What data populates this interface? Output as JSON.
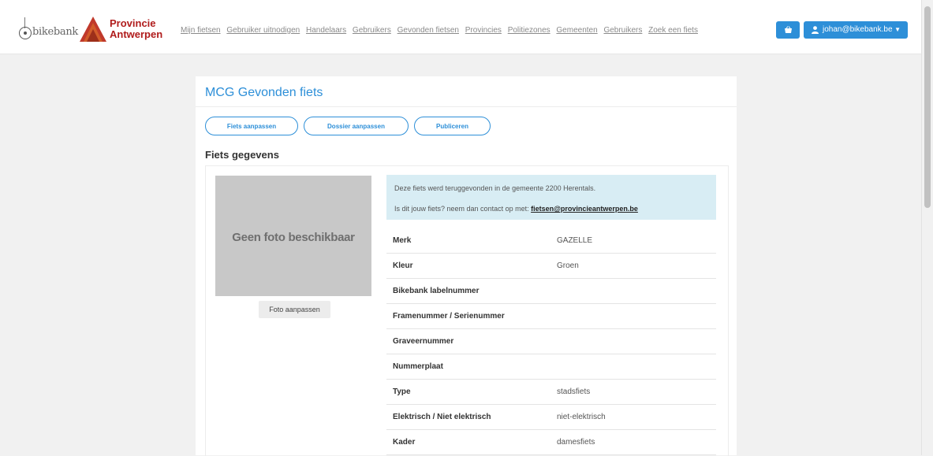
{
  "header": {
    "logo_bikebank": "bikebank",
    "logo_province_line1": "Provincie",
    "logo_province_line2": "Antwerpen",
    "nav": [
      "Mijn fietsen",
      "Gebruiker uitnodigen",
      "Handelaars",
      "Gebruikers",
      "Gevonden fietsen",
      "Provincies",
      "Politiezones",
      "Gemeenten",
      "Gebruikers",
      "Zoek een fiets"
    ],
    "basket_icon": "basket-icon",
    "user_label": "johan@bikebank.be",
    "accent": "#2d8fd8"
  },
  "card": {
    "title": "MCG Gevonden fiets",
    "buttons": [
      "Fiets aanpassen",
      "Dossier aanpassen",
      "Publiceren"
    ],
    "section_title": "Fiets gegevens",
    "photo_placeholder": "Geen foto beschikbaar",
    "photo_button": "Foto aanpassen",
    "alert_line1": "Deze fiets werd teruggevonden in de gemeente 2200 Herentals.",
    "alert_line2_prefix": "Is dit jouw fiets? neem dan contact op met:",
    "alert_email": "fietsen@provincieantwerpen.be",
    "details": [
      {
        "label": "Merk",
        "value": "GAZELLE"
      },
      {
        "label": "Kleur",
        "value": "Groen"
      },
      {
        "label": "Bikebank labelnummer",
        "value": ""
      },
      {
        "label": "Framenummer / Serienummer",
        "value": ""
      },
      {
        "label": "Graveernummer",
        "value": ""
      },
      {
        "label": "Nummerplaat",
        "value": ""
      },
      {
        "label": "Type",
        "value": "stadsfiets"
      },
      {
        "label": "Elektrisch / Niet elektrisch",
        "value": "niet-elektrisch"
      },
      {
        "label": "Kader",
        "value": "damesfiets"
      }
    ]
  }
}
